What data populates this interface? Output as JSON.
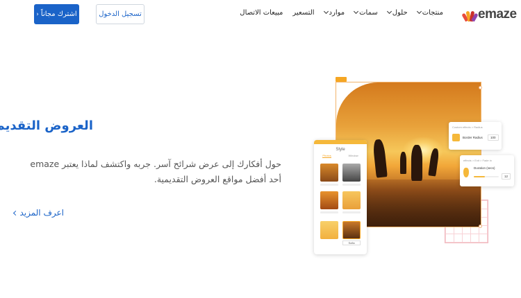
{
  "header": {
    "signup_label": "اشترك مجاناً",
    "login_label": "تسجيل الدخول",
    "logo_text": "emaze",
    "nav": [
      {
        "label": "منتجات",
        "has_dropdown": true
      },
      {
        "label": "حلول",
        "has_dropdown": true
      },
      {
        "label": "سمات",
        "has_dropdown": true
      },
      {
        "label": "موارد",
        "has_dropdown": true
      },
      {
        "label": "التسعير",
        "has_dropdown": false
      },
      {
        "label": "مبيعات الاتصال",
        "has_dropdown": false
      }
    ]
  },
  "hero": {
    "title": "العروض التقديمية",
    "description": "حول أفكارك إلى عرض شرائح آسر. جربه واكتشف لماذا يعتبر emaze أحد أفضل مواقع العروض التقديمية.",
    "learn_more": "اعرف المزيد"
  },
  "illustration": {
    "style_panel": {
      "title": "Style",
      "tabs": [
        "Photos",
        "Window"
      ],
      "selected_label": "Sofia"
    },
    "card_radius": {
      "path": "Custom effects > Radius",
      "label": "Border Radius",
      "value": "100"
    },
    "card_fade": {
      "path": "effects > Exit > Fade in",
      "label": "Duration (secs)",
      "value": "12"
    }
  },
  "colors": {
    "brand_blue": "#1a63c8",
    "accent_orange": "#f5a623"
  }
}
